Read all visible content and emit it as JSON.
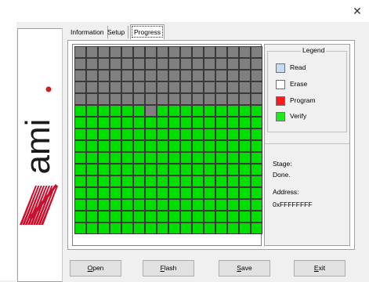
{
  "window": {
    "close_glyph": "✕"
  },
  "tabs": [
    {
      "label": "Information",
      "active": false
    },
    {
      "label": "Setup",
      "active": false
    },
    {
      "label": "Progress",
      "active": true
    }
  ],
  "grid": {
    "columns": 16,
    "rows": 16,
    "gray_rows": 5,
    "extra_gray_cells": [
      {
        "row": 5,
        "col": 6
      }
    ],
    "colors": {
      "gray": "#808080",
      "green": "#00e000"
    }
  },
  "legend": {
    "title": "Legend",
    "items": [
      {
        "label": "Read",
        "color": "#c6dcf5"
      },
      {
        "label": "Erase",
        "color": "#ffffff"
      },
      {
        "label": "Program",
        "color": "#ff1a1a"
      },
      {
        "label": "Verify",
        "color": "#1fe81f"
      }
    ]
  },
  "status": {
    "stage_label": "Stage:",
    "stage_value": "Done.",
    "address_label": "Address:",
    "address_value": "0xFFFFFFFF"
  },
  "buttons": [
    {
      "mnemonic": "O",
      "rest": "pen"
    },
    {
      "mnemonic": "F",
      "rest": "lash"
    },
    {
      "mnemonic": "S",
      "rest": "ave"
    },
    {
      "mnemonic": "E",
      "rest": "xit"
    }
  ],
  "logo": {
    "text": "ami",
    "dot_color": "#cc1f1f",
    "stripe_color": "#c8102e"
  }
}
